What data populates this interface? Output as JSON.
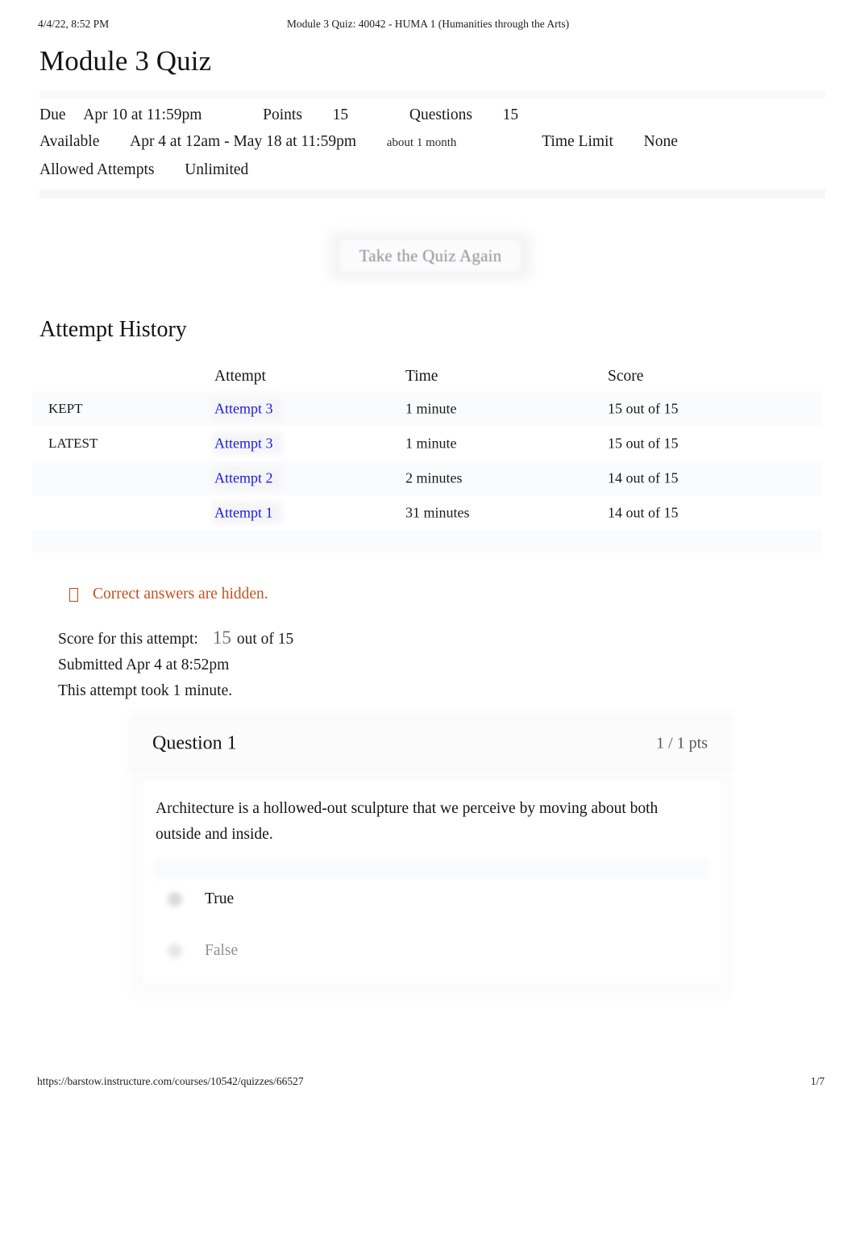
{
  "print_header": {
    "date": "4/4/22, 8:52 PM",
    "doc_title": "Module 3 Quiz: 40042 - HUMA 1 (Humanities through the Arts)"
  },
  "page_title": "Module 3 Quiz",
  "quiz_meta": {
    "due_label": "Due",
    "due_value": "Apr 10 at 11:59pm",
    "points_label": "Points",
    "points_value": "15",
    "questions_label": "Questions",
    "questions_value": "15",
    "available_label": "Available",
    "available_value": "Apr 4 at 12am - May 18 at 11:59pm",
    "available_note": "about 1 month",
    "time_limit_label": "Time Limit",
    "time_limit_value": "None",
    "allowed_attempts_label": "Allowed Attempts",
    "allowed_attempts_value": "Unlimited"
  },
  "take_again_button": {
    "label": "Take the Quiz Again"
  },
  "attempt_history": {
    "heading": "Attempt History",
    "columns": {
      "flag": "",
      "attempt": "Attempt",
      "time": "Time",
      "score": "Score"
    },
    "rows": [
      {
        "flag": "KEPT",
        "attempt": "Attempt 3",
        "time": "1 minute",
        "score": "15 out of 15"
      },
      {
        "flag": "LATEST",
        "attempt": "Attempt 3",
        "time": "1 minute",
        "score": "15 out of 15"
      },
      {
        "flag": "",
        "attempt": "Attempt 2",
        "time": "2 minutes",
        "score": "14 out of 15"
      },
      {
        "flag": "",
        "attempt": "Attempt 1",
        "time": "31 minutes",
        "score": "14 out of 15"
      }
    ]
  },
  "notice": {
    "icon": "hidden-eye-icon",
    "text": "Correct answers are hidden.",
    "color": "#c4511e"
  },
  "attempt_summary": {
    "score_prefix": "Score for this attempt:",
    "score_value": "15",
    "score_suffix": "out of 15",
    "submitted": "Submitted Apr 4 at 8:52pm",
    "duration": "This attempt took 1 minute."
  },
  "question": {
    "title": "Question 1",
    "points": "1 / 1 pts",
    "text": "Architecture is a hollowed-out sculpture that we perceive by moving about both outside and inside.",
    "answers": [
      {
        "label": "True",
        "selected": true
      },
      {
        "label": "False",
        "selected": false
      }
    ]
  },
  "footer": {
    "url": "https://barstow.instructure.com/courses/10542/quizzes/66527",
    "page": "1/7"
  },
  "colors": {
    "link": "#1b1bdd",
    "notice": "#c4511e",
    "muted": "#8e9094"
  }
}
